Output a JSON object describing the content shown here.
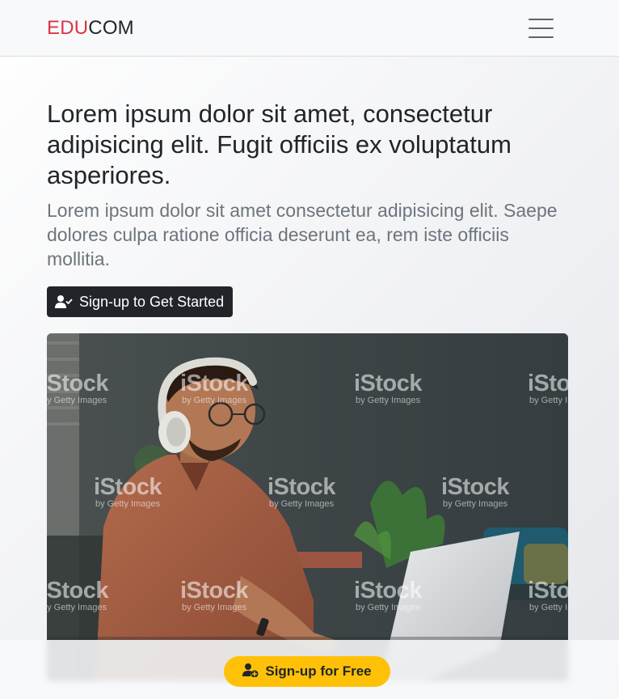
{
  "navbar": {
    "brand_part1": "EDU",
    "brand_part2": "COM",
    "brand_color_1": "#dc3545",
    "brand_color_2": "#212529",
    "menu_icon": "hamburger-menu-icon"
  },
  "hero": {
    "title": "Lorem ipsum dolor sit amet, consectetur adipisicing elit. Fugit officiis ex voluptatum asperiores.",
    "lead": "Lorem ipsum dolor sit amet consectetur adipisicing elit. Saepe dolores culpa ratione officia deserunt ea, rem iste officiis mollitia.",
    "cta_label": "Sign-up to Get Started",
    "cta_icon": "user-check-icon",
    "cta_color": "#212529"
  },
  "image": {
    "watermark_main": "iStock",
    "watermark_sub": "by Getty Images"
  },
  "footer_cta": {
    "label": "Sign-up for Free",
    "icon": "user-plus-icon",
    "color": "#ffc107"
  }
}
